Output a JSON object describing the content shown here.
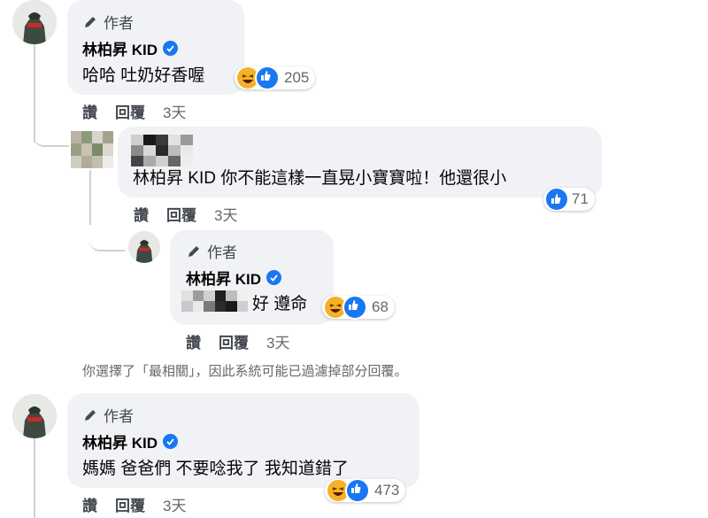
{
  "author_label": "作者",
  "comments": [
    {
      "name": "林柏昇 KID",
      "text": "哈哈 吐奶好香喔",
      "reaction_count": "205",
      "actions": {
        "like": "讚",
        "reply": "回覆",
        "time": "3天"
      }
    },
    {
      "name": "",
      "text": "林柏昇 KID 你不能這樣一直晃小寶寶啦！他還很小",
      "reaction_count": "71",
      "actions": {
        "like": "讚",
        "reply": "回覆",
        "time": "3天"
      }
    },
    {
      "name": "林柏昇 KID",
      "text": "好 遵命",
      "reaction_count": "68",
      "actions": {
        "like": "讚",
        "reply": "回覆",
        "time": "3天"
      }
    },
    {
      "name": "林柏昇 KID",
      "text": "媽媽 爸爸們 不要唸我了 我知道錯了",
      "reaction_count": "473",
      "actions": {
        "like": "讚",
        "reply": "回覆",
        "time": "3天"
      }
    }
  ],
  "filter_notice": "你選擇了「最相關」，因此系統可能已過濾掉部分回覆。",
  "colors": {
    "like_blue": "#1877f2",
    "haha_yellow": "#f7b125",
    "bubble_bg": "#f0f2f5"
  },
  "icons": [
    "pencil-icon",
    "verified-badge-icon",
    "haha-reaction-icon",
    "like-reaction-icon"
  ]
}
